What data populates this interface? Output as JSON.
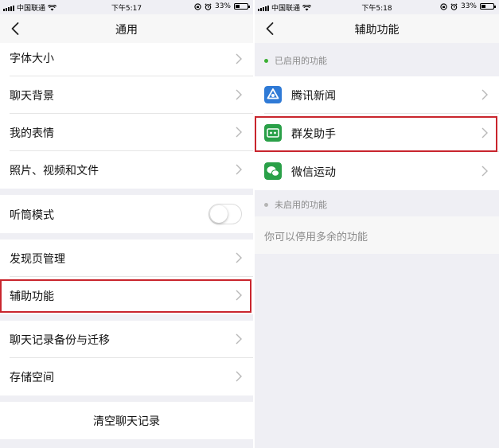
{
  "colors": {
    "highlight": "#c9252d",
    "enabled_dot": "#3cb034",
    "disabled_dot": "#b5b5b5",
    "page_background": "#efeff4"
  },
  "left": {
    "status": {
      "carrier": "中国联通",
      "time": "下午5:17",
      "battery": "33%",
      "battery_fraction": 0.33
    },
    "nav": {
      "title": "通用",
      "back_icon": "chevron-left-icon"
    },
    "items": [
      {
        "label": "字体大小"
      },
      {
        "label": "聊天背景"
      },
      {
        "label": "我的表情"
      },
      {
        "label": "照片、视频和文件"
      },
      {
        "label": "听筒模式",
        "toggle_on": false
      },
      {
        "label": "发现页管理"
      },
      {
        "label": "辅助功能",
        "highlighted": true
      },
      {
        "label": "聊天记录备份与迁移"
      },
      {
        "label": "存储空间"
      }
    ],
    "clear_chat": "清空聊天记录"
  },
  "right": {
    "status": {
      "carrier": "中国联通",
      "time": "下午5:18",
      "battery": "33%",
      "battery_fraction": 0.33
    },
    "nav": {
      "title": "辅助功能",
      "back_icon": "chevron-left-icon"
    },
    "enabled_header": "已启用的功能",
    "enabled_items": [
      {
        "label": "腾讯新闻",
        "icon": "tencent-news-icon",
        "icon_color": "#2f7ad6"
      },
      {
        "label": "群发助手",
        "icon": "broadcast-assistant-icon",
        "icon_color": "#2aa048",
        "highlighted": true
      },
      {
        "label": "微信运动",
        "icon": "wechat-sports-icon",
        "icon_color": "#2aa048"
      }
    ],
    "disabled_header": "未启用的功能",
    "disabled_hint": "你可以停用多余的功能"
  }
}
